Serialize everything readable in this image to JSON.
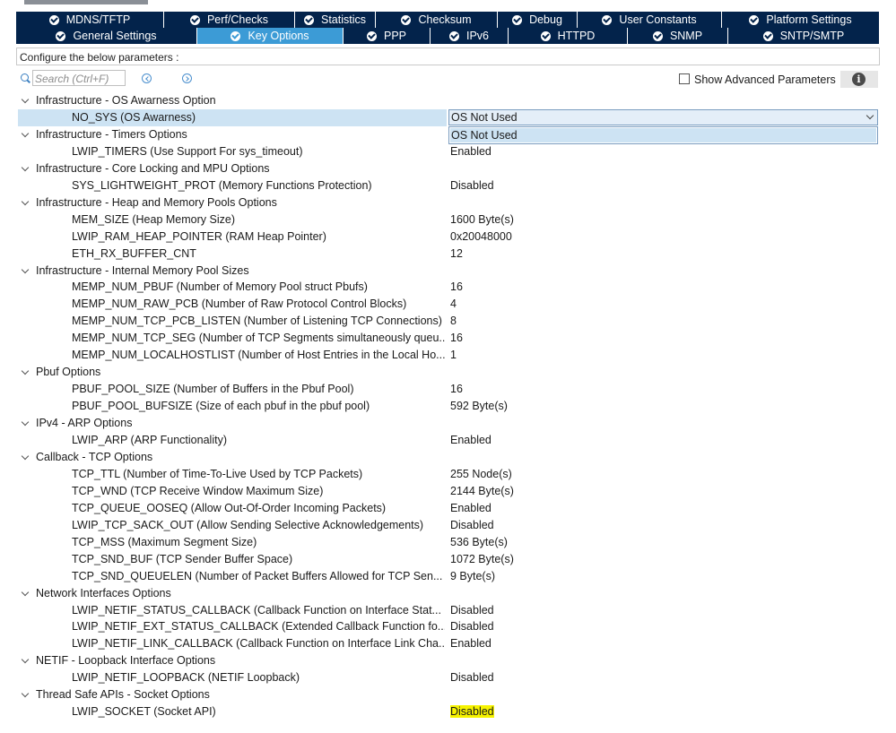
{
  "tabs_row1": [
    {
      "label": "MDNS/TFTP",
      "w": 165,
      "active": false
    },
    {
      "label": "Perf/Checks",
      "w": 146,
      "active": false
    },
    {
      "label": "Statistics",
      "w": 90,
      "active": false
    },
    {
      "label": "Checksum",
      "w": 136,
      "active": false
    },
    {
      "label": "Debug",
      "w": 89,
      "active": false
    },
    {
      "label": "User Constants",
      "w": 161,
      "active": false
    },
    {
      "label": "Platform Settings",
      "w": 176,
      "active": false
    }
  ],
  "tabs_row2": [
    {
      "label": "General Settings",
      "w": 202,
      "active": false
    },
    {
      "label": "Key Options",
      "w": 163,
      "active": true
    },
    {
      "label": "PPP",
      "w": 97,
      "active": false
    },
    {
      "label": "IPv6",
      "w": 87,
      "active": false
    },
    {
      "label": "HTTPD",
      "w": 133,
      "active": false
    },
    {
      "label": "SNMP",
      "w": 112,
      "active": false
    },
    {
      "label": "SNTP/SMTP",
      "w": 169,
      "active": false
    }
  ],
  "config_text": "Configure the below parameters :",
  "search": {
    "placeholder": "Search (Ctrl+F)"
  },
  "show_advanced": "Show Advanced Parameters",
  "dropdown": {
    "value": "OS Not Used",
    "options": [
      "OS Not Used"
    ]
  },
  "rows": [
    {
      "kind": "group",
      "label": "Infrastructure - OS Awarness Option"
    },
    {
      "kind": "param",
      "name": "NO_SYS (OS Awarness)",
      "value": "",
      "selected": true
    },
    {
      "kind": "group",
      "label": "Infrastructure - Timers Options"
    },
    {
      "kind": "param",
      "name": "LWIP_TIMERS (Use Support For sys_timeout)",
      "value": "Enabled"
    },
    {
      "kind": "group",
      "label": "Infrastructure - Core Locking and MPU Options"
    },
    {
      "kind": "param",
      "name": "SYS_LIGHTWEIGHT_PROT (Memory Functions Protection)",
      "value": "Disabled"
    },
    {
      "kind": "group",
      "label": "Infrastructure - Heap and Memory Pools Options"
    },
    {
      "kind": "param",
      "name": "MEM_SIZE (Heap Memory Size)",
      "value": "1600 Byte(s)"
    },
    {
      "kind": "param",
      "name": "LWIP_RAM_HEAP_POINTER (RAM Heap Pointer)",
      "value": "0x20048000"
    },
    {
      "kind": "param",
      "name": "ETH_RX_BUFFER_CNT",
      "value": "12"
    },
    {
      "kind": "group",
      "label": "Infrastructure - Internal Memory Pool Sizes"
    },
    {
      "kind": "param",
      "name": "MEMP_NUM_PBUF (Number of Memory Pool struct Pbufs)",
      "value": "16"
    },
    {
      "kind": "param",
      "name": "MEMP_NUM_RAW_PCB (Number of Raw Protocol Control Blocks)",
      "value": "4"
    },
    {
      "kind": "param",
      "name": "MEMP_NUM_TCP_PCB_LISTEN (Number of Listening TCP Connections)",
      "value": "8"
    },
    {
      "kind": "param",
      "name": "MEMP_NUM_TCP_SEG (Number of TCP Segments simultaneously queu...",
      "value": "16"
    },
    {
      "kind": "param",
      "name": "MEMP_NUM_LOCALHOSTLIST (Number of Host Entries in the Local Ho...",
      "value": "1"
    },
    {
      "kind": "group",
      "label": "Pbuf Options"
    },
    {
      "kind": "param",
      "name": "PBUF_POOL_SIZE (Number of Buffers in the Pbuf Pool)",
      "value": "16"
    },
    {
      "kind": "param",
      "name": "PBUF_POOL_BUFSIZE (Size of each pbuf in the pbuf pool)",
      "value": "592 Byte(s)"
    },
    {
      "kind": "group",
      "label": "IPv4 - ARP Options"
    },
    {
      "kind": "param",
      "name": "LWIP_ARP (ARP Functionality)",
      "value": "Enabled"
    },
    {
      "kind": "group",
      "label": "Callback - TCP Options"
    },
    {
      "kind": "param",
      "name": "TCP_TTL (Number of Time-To-Live Used by TCP Packets)",
      "value": "255 Node(s)"
    },
    {
      "kind": "param",
      "name": "TCP_WND (TCP Receive Window Maximum Size)",
      "value": "2144 Byte(s)"
    },
    {
      "kind": "param",
      "name": "TCP_QUEUE_OOSEQ (Allow Out-Of-Order Incoming Packets)",
      "value": "Enabled"
    },
    {
      "kind": "param",
      "name": "LWIP_TCP_SACK_OUT (Allow Sending Selective Acknowledgements)",
      "value": "Disabled"
    },
    {
      "kind": "param",
      "name": "TCP_MSS (Maximum Segment Size)",
      "value": "536 Byte(s)"
    },
    {
      "kind": "param",
      "name": "TCP_SND_BUF (TCP Sender Buffer Space)",
      "value": "1072 Byte(s)"
    },
    {
      "kind": "param",
      "name": "TCP_SND_QUEUELEN (Number of Packet Buffers Allowed for TCP Sen...",
      "value": "9 Byte(s)"
    },
    {
      "kind": "group",
      "label": "Network Interfaces Options"
    },
    {
      "kind": "param",
      "name": "LWIP_NETIF_STATUS_CALLBACK (Callback Function on Interface Stat...",
      "value": "Disabled"
    },
    {
      "kind": "param",
      "name": "LWIP_NETIF_EXT_STATUS_CALLBACK (Extended Callback Function fo...",
      "value": "Disabled"
    },
    {
      "kind": "param",
      "name": "LWIP_NETIF_LINK_CALLBACK (Callback Function on Interface Link Cha...",
      "value": "Enabled"
    },
    {
      "kind": "group",
      "label": "NETIF - Loopback Interface Options"
    },
    {
      "kind": "param",
      "name": "LWIP_NETIF_LOOPBACK (NETIF Loopback)",
      "value": "Disabled"
    },
    {
      "kind": "group",
      "label": "Thread Safe APIs - Socket Options"
    },
    {
      "kind": "param",
      "name": "LWIP_SOCKET (Socket API)",
      "value": "Disabled",
      "highlight": true
    }
  ]
}
